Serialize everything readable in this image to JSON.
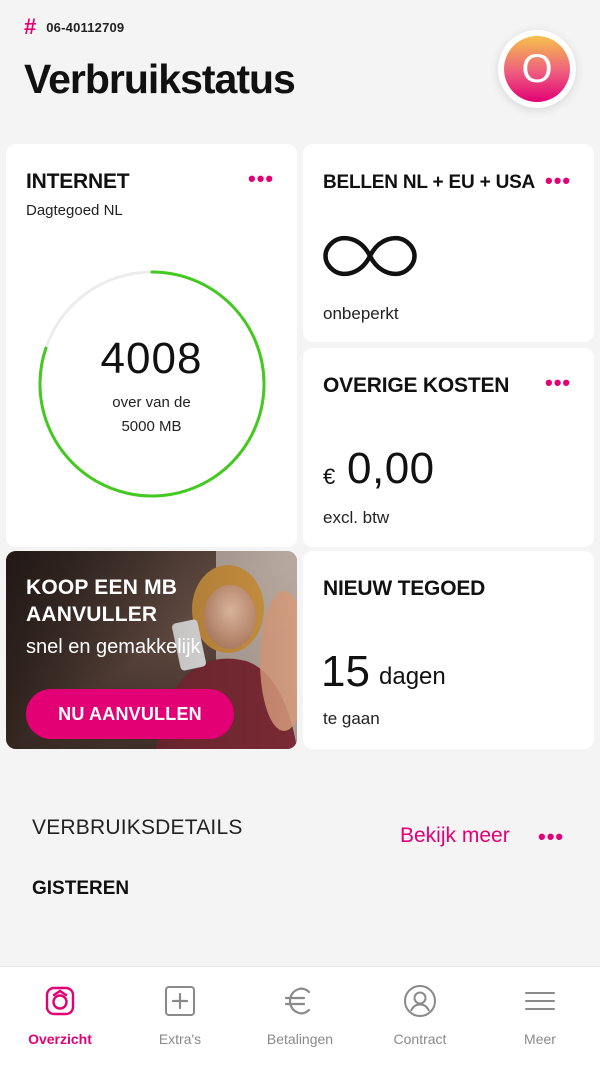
{
  "header": {
    "hash_symbol": "#",
    "phone_number": "06-40112709",
    "title": "Verbruikstatus",
    "avatar_letter": "O"
  },
  "cards": {
    "internet": {
      "title": "INTERNET",
      "subtitle": "Dagtegoed NL",
      "menu": "•••",
      "remaining": "4008",
      "label_line1": "over van de",
      "label_line2": "5000 MB",
      "remaining_fraction": 0.8016,
      "ring_color": "#43c91f"
    },
    "bellen": {
      "title": "BELLEN NL + EU + USA",
      "menu": "•••",
      "icon": "infinity-icon",
      "label": "onbeperkt"
    },
    "kosten": {
      "title": "OVERIGE KOSTEN",
      "menu": "•••",
      "currency": "€",
      "amount": "0,00",
      "label": "excl. btw"
    },
    "promo": {
      "title": "KOOP EEN MB AANVULLER",
      "subtitle": "snel en gemakkelijk",
      "button": "NU AANVULLEN"
    },
    "tegoed": {
      "title": "NIEUW TEGOED",
      "days": "15",
      "unit": "dagen",
      "label": "te gaan"
    }
  },
  "details": {
    "title": "VERBRUIKSDETAILS",
    "link": "Bekijk meer",
    "menu": "•••",
    "section": "GISTEREN"
  },
  "nav": {
    "items": [
      {
        "label": "Overzicht",
        "icon": "home-icon",
        "active": true
      },
      {
        "label": "Extra's",
        "icon": "plus-square-icon",
        "active": false
      },
      {
        "label": "Betalingen",
        "icon": "euro-icon",
        "active": false
      },
      {
        "label": "Contract",
        "icon": "user-circle-icon",
        "active": false
      },
      {
        "label": "Meer",
        "icon": "menu-icon",
        "active": false
      }
    ]
  },
  "colors": {
    "brand": "#e20074",
    "ring": "#43c91f",
    "background": "#f4f4f4"
  }
}
